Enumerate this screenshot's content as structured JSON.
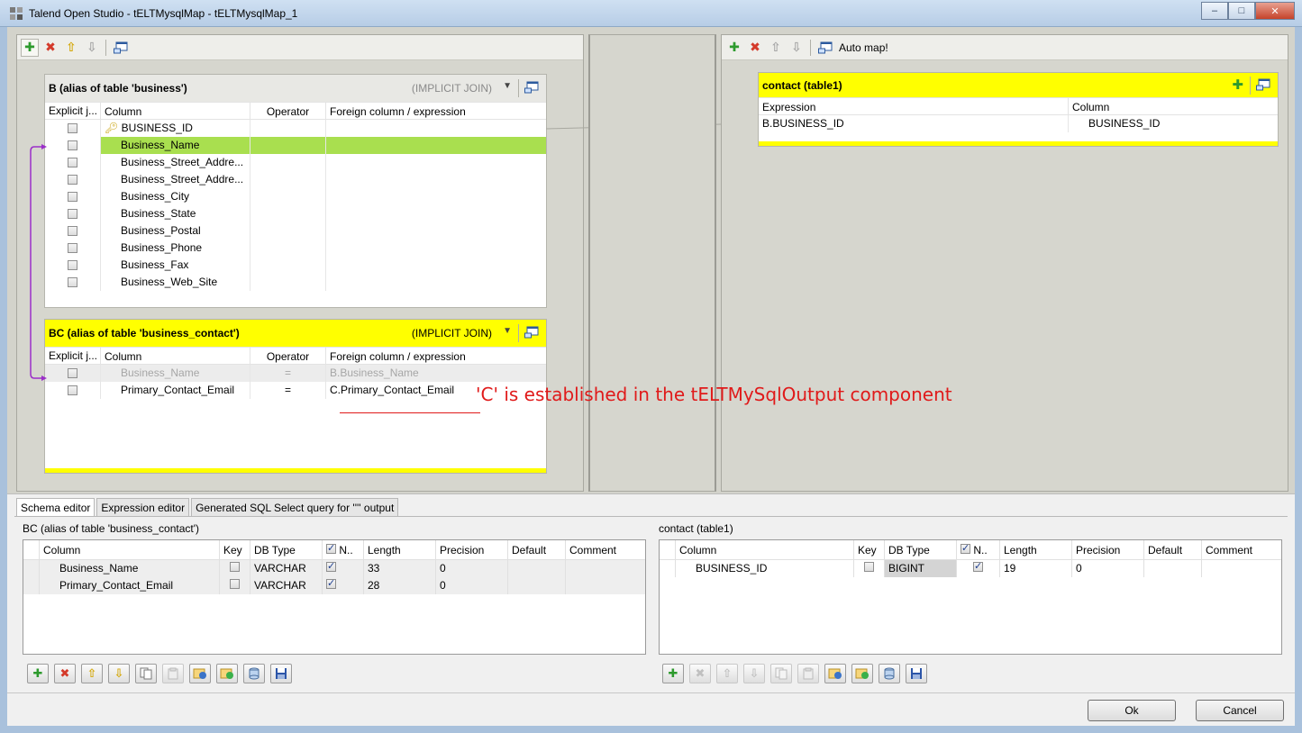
{
  "window": {
    "title": "Talend Open Studio - tELTMysqlMap - tELTMysqlMap_1",
    "minimize": "–",
    "maximize": "□",
    "close": "✕"
  },
  "left_toolbar": {},
  "right_toolbar": {
    "auto_map": "Auto map!"
  },
  "input_tables": [
    {
      "header": "B  (alias of table 'business')",
      "join": "(IMPLICIT JOIN)",
      "columns_header": [
        "Explicit j...",
        "Column",
        "Operator",
        "Foreign column / expression"
      ],
      "rows": [
        {
          "column": "BUSINESS_ID",
          "operator": "",
          "expression": "",
          "key": true
        },
        {
          "column": "Business_Name",
          "operator": "",
          "expression": "",
          "selected": true
        },
        {
          "column": "Business_Street_Addre...",
          "operator": "",
          "expression": ""
        },
        {
          "column": "Business_Street_Addre...",
          "operator": "",
          "expression": ""
        },
        {
          "column": "Business_City",
          "operator": "",
          "expression": ""
        },
        {
          "column": "Business_State",
          "operator": "",
          "expression": ""
        },
        {
          "column": "Business_Postal",
          "operator": "",
          "expression": ""
        },
        {
          "column": "Business_Phone",
          "operator": "",
          "expression": ""
        },
        {
          "column": "Business_Fax",
          "operator": "",
          "expression": ""
        },
        {
          "column": "Business_Web_Site",
          "operator": "",
          "expression": ""
        }
      ]
    },
    {
      "header": "BC  (alias of table 'business_contact')",
      "join": "(IMPLICIT JOIN)",
      "columns_header": [
        "Explicit j...",
        "Column",
        "Operator",
        "Foreign column / expression"
      ],
      "rows": [
        {
          "column": "Business_Name",
          "operator": "=",
          "expression": "B.Business_Name"
        },
        {
          "column": "Primary_Contact_Email",
          "operator": "=",
          "expression": "C.Primary_Contact_Email"
        }
      ]
    }
  ],
  "output_table": {
    "header": "contact (table1)",
    "columns_header": [
      "Expression",
      "Column"
    ],
    "rows": [
      {
        "expression": "B.BUSINESS_ID",
        "column": "BUSINESS_ID"
      }
    ]
  },
  "annotation": "'C' is established in the tELTMySqlOutput component",
  "tabs": [
    "Schema editor",
    "Expression editor",
    "Generated SQL Select query for '''' output"
  ],
  "schema_left": {
    "title": "BC  (alias of table 'business_contact')",
    "headers": [
      "Column",
      "Key",
      "DB Type",
      "N..",
      "Length",
      "Precision",
      "Default",
      "Comment"
    ],
    "rows": [
      {
        "column": "Business_Name",
        "db_type": "VARCHAR",
        "length": "33",
        "precision": "0"
      },
      {
        "column": "Primary_Contact_Email",
        "db_type": "VARCHAR",
        "length": "28",
        "precision": "0"
      }
    ]
  },
  "schema_right": {
    "title": "contact (table1)",
    "headers": [
      "Column",
      "Key",
      "DB Type",
      "N..",
      "Length",
      "Precision",
      "Default",
      "Comment"
    ],
    "rows": [
      {
        "column": "BUSINESS_ID",
        "db_type": "BIGINT",
        "length": "19",
        "precision": "0"
      }
    ]
  },
  "dialog": {
    "ok": "Ok",
    "cancel": "Cancel"
  },
  "colors": {
    "selected_row": "#a9df4f",
    "header_yellow": "#ffff00",
    "annotation_red": "#e01a1a"
  }
}
